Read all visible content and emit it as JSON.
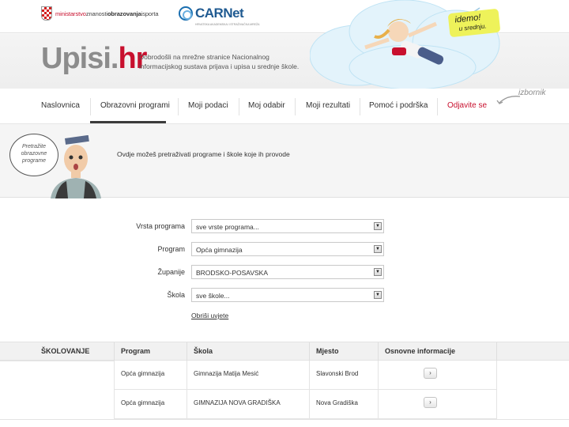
{
  "header": {
    "ministry_prefix": "ministarstvo",
    "ministry_mid": "znanosti",
    "ministry_bold": "obrazovanja",
    "ministry_suffix": "isporta",
    "carnet_name": "CARNet",
    "carnet_sub": "HRVATSKA AKADEMSKA I ISTRAŽIVAČKA MREŽA",
    "brand_main": "Upisi.",
    "brand_tld": "hr",
    "tagline": "Dobrodošli na mrežne stranice Nacionalnog informacijskog sustava prijava i upisa u srednje škole.",
    "badge_main": "idemo!",
    "badge_sub": "u srednju."
  },
  "izbornik_label": "izbornik",
  "nav": {
    "items": [
      {
        "label": "Naslovnica"
      },
      {
        "label": "Obrazovni programi"
      },
      {
        "label": "Moji podaci"
      },
      {
        "label": "Moj odabir"
      },
      {
        "label": "Moji rezultati"
      },
      {
        "label": "Pomoć i podrška"
      },
      {
        "label": "Odjavite se"
      }
    ],
    "active_index": 1
  },
  "intro": {
    "bubble_lines": [
      "Pretražite",
      "obrazovne",
      "programe"
    ],
    "text": "Ovdje možeš pretraživati programe i škole koje ih provode"
  },
  "filters": [
    {
      "label": "Vrsta programa",
      "value": "sve vrste programa..."
    },
    {
      "label": "Program",
      "value": "Opća gimnazija"
    },
    {
      "label": "Županije",
      "value": "BRODSKO-POSAVSKA"
    },
    {
      "label": "Škola",
      "value": "sve škole..."
    }
  ],
  "clear_link": "Obriši uvjete",
  "table": {
    "headers": [
      "ŠKOLOVANJE",
      "Program",
      "Škola",
      "Mjesto",
      "Osnovne informacije"
    ],
    "rows": [
      {
        "program": "Opća gimnazija",
        "school": "Gimnazija Matija Mesić",
        "place": "Slavonski Brod",
        "info_icon": "chevron-right-icon"
      },
      {
        "program": "Opća gimnazija",
        "school": "GIMNAZIJA NOVA GRADIŠKA",
        "place": "Nova Gradiška",
        "info_icon": "chevron-right-icon"
      }
    ]
  },
  "colors": {
    "brand_red": "#c8102e",
    "brand_grey": "#8c8c8c",
    "badge_yellow": "#eef25a"
  }
}
